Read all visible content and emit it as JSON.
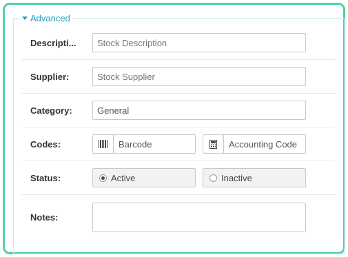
{
  "section": {
    "legend": "Advanced",
    "expanded": true,
    "accent_color": "#1a9fc7",
    "frame_color": "#4dd2a3"
  },
  "fields": {
    "description": {
      "label": "Descripti...",
      "placeholder": "Stock Description"
    },
    "supplier": {
      "label": "Supplier:",
      "placeholder": "Stock Supplier"
    },
    "category": {
      "label": "Category:",
      "value": "General"
    },
    "codes": {
      "label": "Codes:",
      "barcode_placeholder": "Barcode",
      "barcode_icon": "barcode-icon",
      "accounting_placeholder": "Accounting Code",
      "accounting_icon": "calculator-icon"
    },
    "status": {
      "label": "Status:",
      "options": [
        "Active",
        "Inactive"
      ],
      "selected": "Active"
    },
    "notes": {
      "label": "Notes:",
      "value": ""
    }
  }
}
